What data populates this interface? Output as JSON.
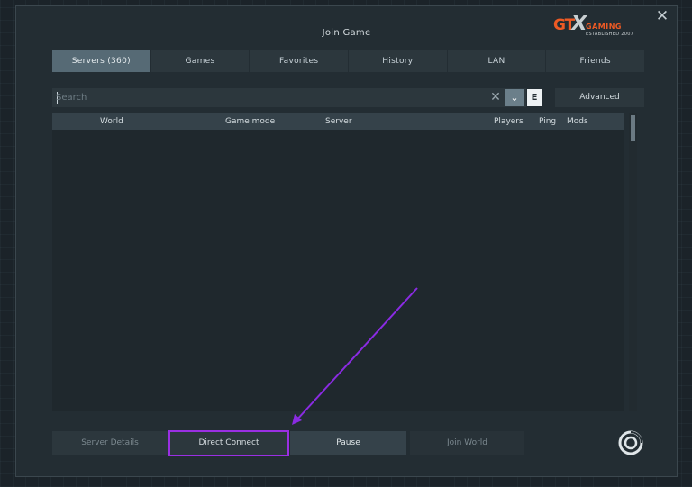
{
  "dialog": {
    "title": "Join Game",
    "close_label": "✕",
    "logo": {
      "gt": "GT",
      "x": "X",
      "gaming": "GAMING",
      "established": "ESTABLISHED 2007"
    }
  },
  "tabs": [
    {
      "label": "Servers (360)",
      "active": true
    },
    {
      "label": "Games"
    },
    {
      "label": "Favorites"
    },
    {
      "label": "History"
    },
    {
      "label": "LAN"
    },
    {
      "label": "Friends"
    }
  ],
  "search": {
    "placeholder": "Search",
    "value": "",
    "clear_icon": "✕",
    "sort_icon": "⌄",
    "filter_label": "E"
  },
  "advanced_label": "Advanced",
  "table": {
    "columns": [
      "World",
      "Game mode",
      "Server",
      "Players",
      "Ping",
      "Mods"
    ],
    "rows": []
  },
  "buttons": {
    "server_details": "Server Details",
    "direct_connect": "Direct Connect",
    "pause": "Pause",
    "join_world": "Join World"
  },
  "colors": {
    "highlight_box": "#9a2fe3",
    "arrow": "#8a2be2",
    "logo_orange": "#ee5a24"
  }
}
